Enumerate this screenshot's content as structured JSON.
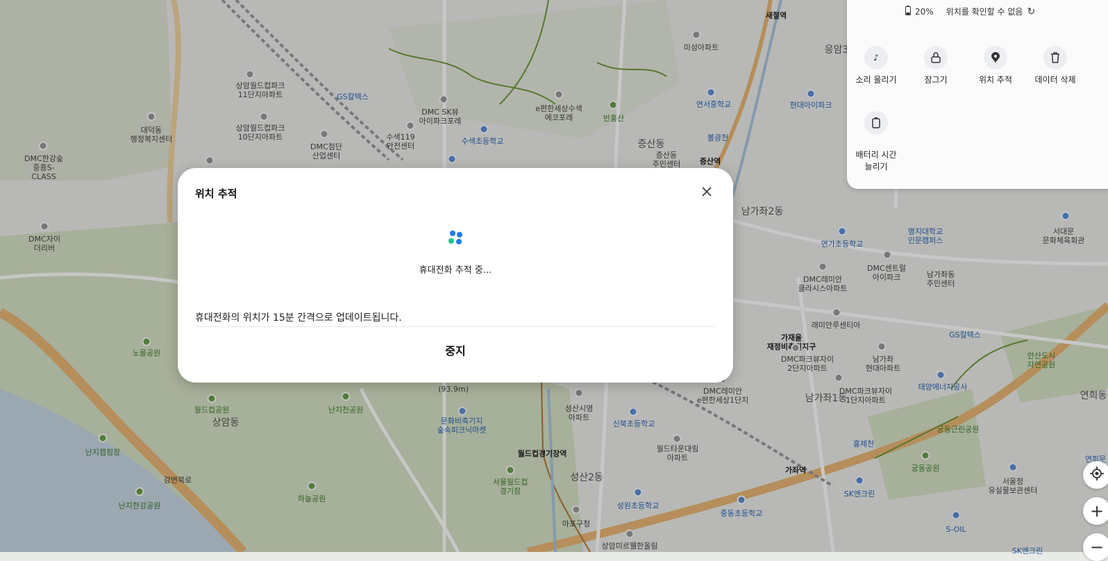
{
  "colors": {
    "water": "#c4d6e4",
    "park": "#cfdcbf",
    "road_major": "#e7b36a",
    "road_minor": "#ffffff",
    "rail": "#9a9a9a",
    "trail": "#6e9a3a",
    "subway_line6": "#b5773c",
    "accent_blue": "#1f7aed",
    "accent_green": "#1cc38a"
  },
  "map": {
    "labels": [
      {
        "id": "l1",
        "text": "새절역",
        "cls": "bold"
      },
      {
        "id": "l2",
        "text": "미성아파트",
        "cls": ""
      },
      {
        "id": "l3",
        "text": "응암3",
        "cls": "big"
      },
      {
        "id": "l4",
        "text": "상암월드컵파크\n11단지아파트",
        "cls": ""
      },
      {
        "id": "l5",
        "text": "GS칼텍스",
        "cls": "blue"
      },
      {
        "id": "l6",
        "text": "연서중학교",
        "cls": "blue"
      },
      {
        "id": "l7",
        "text": "현대아이파크",
        "cls": "blue"
      },
      {
        "id": "l8",
        "text": "대덕동\n행정복지센터",
        "cls": ""
      },
      {
        "id": "l9",
        "text": "DMC SK뷰\n아이파크포레",
        "cls": ""
      },
      {
        "id": "l10",
        "text": "e편한세상수색\n에코포레",
        "cls": ""
      },
      {
        "id": "l11",
        "text": "반홍산",
        "cls": "green"
      },
      {
        "id": "l12",
        "text": "상암월드컵파크\n10단지아파트",
        "cls": ""
      },
      {
        "id": "l13",
        "text": "수색119\n안전센터",
        "cls": ""
      },
      {
        "id": "l14",
        "text": "수색초등학교",
        "cls": "blue"
      },
      {
        "id": "l15",
        "text": "불광천",
        "cls": "blue"
      },
      {
        "id": "l16",
        "text": "DMC한강숲\n중흥S-\nCLASS",
        "cls": ""
      },
      {
        "id": "l17",
        "text": "DMC첨단\n산업센터",
        "cls": ""
      },
      {
        "id": "l18",
        "text": "증산동",
        "cls": "big"
      },
      {
        "id": "l19",
        "text": "증산동\n주민센터",
        "cls": ""
      },
      {
        "id": "l20",
        "text": "증산역",
        "cls": "bold"
      },
      {
        "id": "l21",
        "text": "DMC자이\n더리버",
        "cls": ""
      },
      {
        "id": "l22",
        "text": "남가좌2동",
        "cls": "big"
      },
      {
        "id": "l23",
        "text": "연가초등학교",
        "cls": "blue"
      },
      {
        "id": "l24",
        "text": "명지대학교\n인문캠퍼스",
        "cls": "blue"
      },
      {
        "id": "l25",
        "text": "서대문\n문화체육회관",
        "cls": ""
      },
      {
        "id": "l26",
        "text": "DMC센트럴\n아이파크",
        "cls": ""
      },
      {
        "id": "l27",
        "text": "DMC레미안\n클라시스아파트",
        "cls": ""
      },
      {
        "id": "l28",
        "text": "남가좌동\n주민센터",
        "cls": ""
      },
      {
        "id": "l29",
        "text": "래미안루센티아",
        "cls": ""
      },
      {
        "id": "l30",
        "text": "가재울\n재정비촉진지구",
        "cls": "bold"
      },
      {
        "id": "l31",
        "text": "GS칼텍스",
        "cls": "blue"
      },
      {
        "id": "l32",
        "text": "DMC파크뷰자이\n2단지아파트",
        "cls": ""
      },
      {
        "id": "l33",
        "text": "남가좌\n현대아파트",
        "cls": ""
      },
      {
        "id": "l34",
        "text": "안산도시\n자연공원",
        "cls": "green"
      },
      {
        "id": "l35",
        "text": "노을공원",
        "cls": "green"
      },
      {
        "id": "l36",
        "text": "(93.9m)",
        "cls": ""
      },
      {
        "id": "l37",
        "text": "DMC레미안\ne편한세상1단지",
        "cls": ""
      },
      {
        "id": "l38",
        "text": "DMC파크뷰자이\n1단지아파트",
        "cls": ""
      },
      {
        "id": "l39",
        "text": "남가좌1동",
        "cls": "big"
      },
      {
        "id": "l40",
        "text": "태양에너지공사",
        "cls": "blue"
      },
      {
        "id": "l41",
        "text": "연희동",
        "cls": "big"
      },
      {
        "id": "l42",
        "text": "월드컵공원",
        "cls": "green"
      },
      {
        "id": "l43",
        "text": "상암동",
        "cls": "big"
      },
      {
        "id": "l44",
        "text": "난지천공원",
        "cls": "green"
      },
      {
        "id": "l45",
        "text": "문화비축기지\n숲속피크닉마켓",
        "cls": "blue"
      },
      {
        "id": "l46",
        "text": "성산시영\n아파트",
        "cls": ""
      },
      {
        "id": "l47",
        "text": "신북초등학교",
        "cls": "blue"
      },
      {
        "id": "l48",
        "text": "홍제천",
        "cls": "blue"
      },
      {
        "id": "l49",
        "text": "궁동근린공원",
        "cls": "green"
      },
      {
        "id": "l50",
        "text": "난지캠핑장",
        "cls": "green"
      },
      {
        "id": "l51",
        "text": "월드컵경기장역",
        "cls": "bold"
      },
      {
        "id": "l52",
        "text": "월드타운대림\n아파트",
        "cls": ""
      },
      {
        "id": "l53",
        "text": "가좌역",
        "cls": "bold"
      },
      {
        "id": "l54",
        "text": "궁동공원",
        "cls": "green"
      },
      {
        "id": "l55",
        "text": "서울월드컵\n경기장",
        "cls": "green"
      },
      {
        "id": "l56",
        "text": "성산2동",
        "cls": "big"
      },
      {
        "id": "l57",
        "text": "SK엔크린",
        "cls": "blue"
      },
      {
        "id": "l58",
        "text": "서울청\n유실물보관센터",
        "cls": ""
      },
      {
        "id": "l59",
        "text": "하늘공원",
        "cls": "green"
      },
      {
        "id": "l60",
        "text": "성원초등학교",
        "cls": "blue"
      },
      {
        "id": "l61",
        "text": "중동초등학교",
        "cls": "blue"
      },
      {
        "id": "l62",
        "text": "난지한강공원",
        "cls": "green"
      },
      {
        "id": "l63",
        "text": "마포구청",
        "cls": ""
      },
      {
        "id": "l64",
        "text": "S-OIL",
        "cls": "blue"
      },
      {
        "id": "l65",
        "text": "상암미르웰한올림",
        "cls": ""
      },
      {
        "id": "l66",
        "text": "SK엔크린",
        "cls": "blue"
      },
      {
        "id": "l67",
        "text": "강변북로",
        "cls": ""
      },
      {
        "id": "l68",
        "text": "연희문",
        "cls": "blue"
      }
    ]
  },
  "device_panel": {
    "battery": "20%",
    "location_status": "위치를 확인할 수 없음",
    "actions": [
      {
        "label": "소리 울리기",
        "icon": "music-note-icon"
      },
      {
        "label": "잠그기",
        "icon": "lock-icon"
      },
      {
        "label": "위치 추적",
        "icon": "location-pin-icon"
      },
      {
        "label": "데이터 삭제",
        "icon": "trash-icon"
      },
      {
        "label": "배터리 시간\n늘리기",
        "icon": "battery-saver-icon"
      }
    ]
  },
  "dialog": {
    "title": "위치 추적",
    "status": "휴대전화 추적 중...",
    "note": "휴대전화의 위치가 15분 간격으로 업데이트됩니다.",
    "stop_label": "중지"
  },
  "map_controls": {
    "locate_icon": "crosshair-icon",
    "zoom_in_icon": "plus-icon",
    "zoom_out_icon": "minus-icon"
  }
}
